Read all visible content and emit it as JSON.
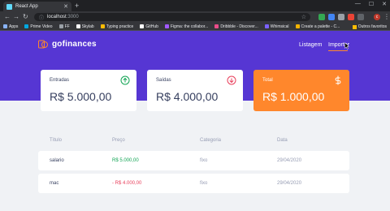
{
  "browser": {
    "tab_title": "React App",
    "url_host": "localhost",
    "url_port": ":3000",
    "bookmarks": [
      {
        "label": "Apps",
        "color": "#8ab4f8"
      },
      {
        "label": "Prime Video",
        "color": "#00a8e1"
      },
      {
        "label": "FF",
        "color": "#9aa0a6"
      },
      {
        "label": "Skylab",
        "color": "#ffffff"
      },
      {
        "label": "Typing practice",
        "color": "#fbbc04"
      },
      {
        "label": "GitHub",
        "color": "#ffffff"
      },
      {
        "label": "Figma: the collabor...",
        "color": "#a259ff"
      },
      {
        "label": "Dribbble - Discover...",
        "color": "#ea4c89"
      },
      {
        "label": "Whimsical",
        "color": "#7b61ff"
      },
      {
        "label": "Create a palette - C...",
        "color": "#f4b400"
      }
    ],
    "other_bookmarks": "Outros favoritos",
    "avatar_letter": "c"
  },
  "app": {
    "logo_text": "gofinances",
    "nav": {
      "listing": "Listagem",
      "import": "Importar"
    },
    "cards": {
      "income": {
        "label": "Entradas",
        "value": "R$ 5.000,00"
      },
      "outcome": {
        "label": "Saídas",
        "value": "R$ 4.000,00"
      },
      "total": {
        "label": "Total",
        "value": "R$ 1.000,00"
      }
    },
    "table": {
      "headers": [
        "Título",
        "Preço",
        "Categoria",
        "Data"
      ],
      "rows": [
        {
          "title": "salario",
          "price": "R$ 5.000,00",
          "category": "fixo",
          "date": "29/04/2020",
          "type": "income"
        },
        {
          "title": "mac",
          "price": "- R$ 4.000,00",
          "category": "fixo",
          "date": "29/04/2020",
          "type": "outcome"
        }
      ]
    }
  },
  "colors": {
    "header_purple": "#5636d3",
    "accent_orange": "#ff872c",
    "income_green": "#12a454",
    "outcome_red": "#e83f5b",
    "text_dark": "#363f5f",
    "text_muted": "#969cb3",
    "page_bg": "#f0f2f5"
  }
}
